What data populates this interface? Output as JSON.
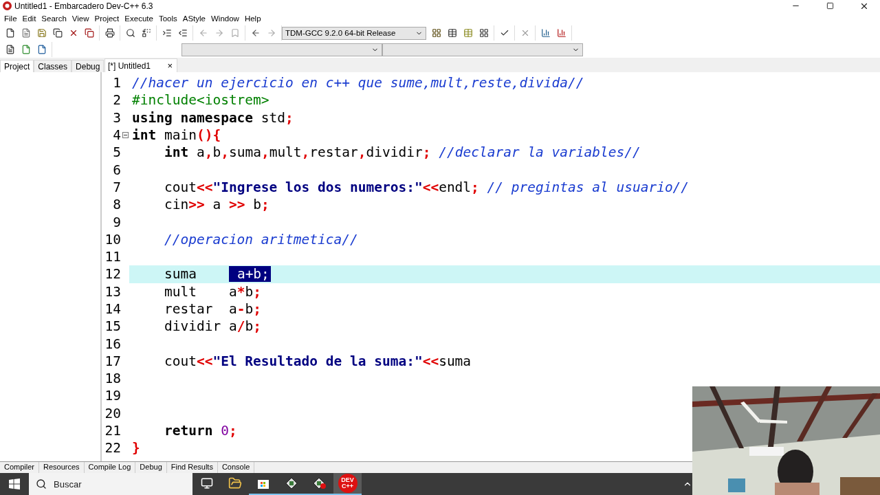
{
  "window": {
    "title": "Untitled1 - Embarcadero Dev-C++ 6.3"
  },
  "menu": [
    "File",
    "Edit",
    "Search",
    "View",
    "Project",
    "Execute",
    "Tools",
    "AStyle",
    "Window",
    "Help"
  ],
  "compiler": {
    "value": "TDM-GCC 9.2.0 64-bit Release"
  },
  "side_tabs": [
    {
      "label": "Project",
      "selected": true
    },
    {
      "label": "Classes",
      "selected": false
    },
    {
      "label": "Debug",
      "selected": false
    }
  ],
  "editor_tabs": [
    {
      "label": "[*] Untitled1",
      "selected": true,
      "close": "×"
    }
  ],
  "lines": [
    {
      "number": "1",
      "active": false,
      "fold": false,
      "tokens": [
        {
          "kind": "comment",
          "text": "//hacer un ejercicio en c++ que sume,mult,reste,divida//"
        }
      ]
    },
    {
      "number": "2",
      "active": false,
      "fold": false,
      "tokens": [
        {
          "kind": "preproc",
          "text": "#include<iostrem>"
        }
      ]
    },
    {
      "number": "3",
      "active": false,
      "fold": false,
      "tokens": [
        {
          "kind": "keyword",
          "text": "using namespace"
        },
        {
          "kind": "plain",
          "text": " std"
        },
        {
          "kind": "symbol",
          "text": ";"
        }
      ]
    },
    {
      "number": "4",
      "active": false,
      "fold": true,
      "tokens": [
        {
          "kind": "keyword",
          "text": "int"
        },
        {
          "kind": "plain",
          "text": " main"
        },
        {
          "kind": "symbol",
          "text": "(){"
        }
      ]
    },
    {
      "number": "5",
      "active": false,
      "fold": false,
      "tokens": [
        {
          "kind": "keyword",
          "text": "    int"
        },
        {
          "kind": "plain",
          "text": " a"
        },
        {
          "kind": "symbol",
          "text": ","
        },
        {
          "kind": "plain",
          "text": "b"
        },
        {
          "kind": "symbol",
          "text": ","
        },
        {
          "kind": "plain",
          "text": "suma"
        },
        {
          "kind": "symbol",
          "text": ","
        },
        {
          "kind": "plain",
          "text": "mult"
        },
        {
          "kind": "symbol",
          "text": ","
        },
        {
          "kind": "plain",
          "text": "restar"
        },
        {
          "kind": "symbol",
          "text": ","
        },
        {
          "kind": "plain",
          "text": "dividir"
        },
        {
          "kind": "symbol",
          "text": ";"
        },
        {
          "kind": "comment",
          "text": " //declarar la variables//"
        }
      ]
    },
    {
      "number": "6",
      "active": false,
      "fold": false
    },
    {
      "number": "7",
      "active": false,
      "fold": false,
      "tokens": [
        {
          "kind": "plain",
          "text": "    cout"
        },
        {
          "kind": "symbol",
          "text": "<<"
        },
        {
          "kind": "string",
          "text": "\"Ingrese los dos numeros:\""
        },
        {
          "kind": "symbol",
          "text": "<<"
        },
        {
          "kind": "plain",
          "text": "endl"
        },
        {
          "kind": "symbol",
          "text": ";"
        },
        {
          "kind": "comment",
          "text": " // pregintas al usuario//"
        }
      ]
    },
    {
      "number": "8",
      "active": false,
      "fold": false,
      "tokens": [
        {
          "kind": "plain",
          "text": "    cin"
        },
        {
          "kind": "symbol",
          "text": ">>"
        },
        {
          "kind": "plain",
          "text": " a "
        },
        {
          "kind": "symbol",
          "text": ">>"
        },
        {
          "kind": "plain",
          "text": " b"
        },
        {
          "kind": "symbol",
          "text": ";"
        }
      ]
    },
    {
      "number": "9",
      "active": false,
      "fold": false
    },
    {
      "number": "10",
      "active": false,
      "fold": false,
      "tokens": [
        {
          "kind": "comment",
          "text": "    //operacion aritmetica//"
        }
      ]
    },
    {
      "number": "11",
      "active": false,
      "fold": false
    },
    {
      "number": "12",
      "active": true,
      "fold": false,
      "tokens": [
        {
          "kind": "plain",
          "text": "    suma    "
        },
        {
          "kind": "selected",
          "text": "a+b;"
        }
      ]
    },
    {
      "number": "13",
      "active": false,
      "fold": false,
      "tokens": [
        {
          "kind": "plain",
          "text": "    mult    a"
        },
        {
          "kind": "symbol",
          "text": "*"
        },
        {
          "kind": "plain",
          "text": "b"
        },
        {
          "kind": "symbol",
          "text": ";"
        }
      ]
    },
    {
      "number": "14",
      "active": false,
      "fold": false,
      "tokens": [
        {
          "kind": "plain",
          "text": "    restar  a"
        },
        {
          "kind": "symbol",
          "text": "-"
        },
        {
          "kind": "plain",
          "text": "b"
        },
        {
          "kind": "symbol",
          "text": ";"
        }
      ]
    },
    {
      "number": "15",
      "active": false,
      "fold": false,
      "tokens": [
        {
          "kind": "plain",
          "text": "    dividir a"
        },
        {
          "kind": "symbol",
          "text": "/"
        },
        {
          "kind": "plain",
          "text": "b"
        },
        {
          "kind": "symbol",
          "text": ";"
        }
      ]
    },
    {
      "number": "16",
      "active": false,
      "fold": false
    },
    {
      "number": "17",
      "active": false,
      "fold": false,
      "tokens": [
        {
          "kind": "plain",
          "text": "    cout"
        },
        {
          "kind": "symbol",
          "text": "<<"
        },
        {
          "kind": "string",
          "text": "\"El Resultado de la suma:\""
        },
        {
          "kind": "symbol",
          "text": "<<"
        },
        {
          "kind": "plain",
          "text": "suma"
        }
      ]
    },
    {
      "number": "18",
      "active": false,
      "fold": false
    },
    {
      "number": "19",
      "active": false,
      "fold": false
    },
    {
      "number": "20",
      "active": false,
      "fold": false
    },
    {
      "number": "21",
      "active": false,
      "fold": false,
      "tokens": [
        {
          "kind": "keyword",
          "text": "    return"
        },
        {
          "kind": "number",
          "text": " 0"
        },
        {
          "kind": "symbol",
          "text": ";"
        }
      ]
    },
    {
      "number": "22",
      "active": false,
      "fold": false,
      "tokens": [
        {
          "kind": "symbol",
          "text": "}"
        }
      ]
    }
  ],
  "bottom_tabs": [
    {
      "label": "Compiler",
      "selected": false
    },
    {
      "label": "Resources",
      "selected": false
    },
    {
      "label": "Compile Log",
      "selected": false
    },
    {
      "label": "Debug",
      "selected": false
    },
    {
      "label": "Find Results",
      "selected": false
    },
    {
      "label": "Console",
      "selected": false
    }
  ],
  "taskbar": {
    "search": {
      "placeholder": "Buscar"
    },
    "apps": [
      {
        "kind": "taskview",
        "running": false,
        "active": false
      },
      {
        "kind": "folder",
        "running": false,
        "active": false
      },
      {
        "kind": "store",
        "running": true,
        "active": false
      },
      {
        "kind": "app",
        "running": true,
        "active": false
      },
      {
        "kind": "app2",
        "running": true,
        "active": false
      },
      {
        "kind": "devcpp",
        "running": true,
        "active": true,
        "label": "DEV C++"
      }
    ]
  }
}
